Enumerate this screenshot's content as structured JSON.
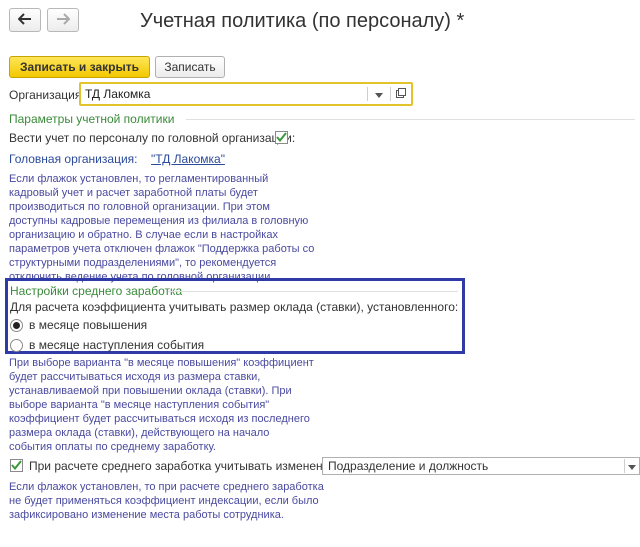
{
  "window": {
    "title": "Учетная политика (по персоналу) *"
  },
  "toolbar": {
    "save_close_label": "Записать и закрыть",
    "save_label": "Записать"
  },
  "organization": {
    "label": "Организация:",
    "value": "ТД Лакомка"
  },
  "params_section": {
    "title": "Параметры учетной политики",
    "head_org_checkbox_label": "Вести учет по персоналу по головной организации:",
    "head_org_checkbox_checked": true,
    "head_org_label": "Головная организация:",
    "head_org_link": "\"ТД Лакомка\"",
    "hint_lines": [
      "Если флажок установлен, то регламентированный",
      "кадровый учет и расчет заработной платы будет",
      "производиться по головной организации. При этом",
      "доступны кадровые перемещения из филиала в головную",
      "организацию и обратно. В случае если в настройках",
      "параметров учета отключен флажок \"Поддержка работы со",
      "структурными подразделениями\", то рекомендуется",
      "отключить ведение учета по головной организации."
    ]
  },
  "avg_salary_section": {
    "title": "Настройки среднего заработка",
    "question": "Для расчета коэффициента учитывать размер оклада (ставки), установленного:",
    "options": [
      "в месяце повышения",
      "в месяце наступления события"
    ],
    "selected_option": "в месяце повышения",
    "hint_lines": [
      "При выборе варианта \"в месяце повышения\" коэффициент",
      "будет рассчитываться исходя из размера ставки,",
      "устанавливаемой при повышении оклада (ставки). При",
      "выборе варианта \"в месяце наступления события\"",
      "коэффициент будет рассчитываться исходя из последнего",
      "размера оклада (ставки), действующего на начало",
      "события оплаты по среднему заработку."
    ]
  },
  "changes_section": {
    "checkbox_label": "При расчете среднего заработка учитывать изменения:",
    "checkbox_checked": true,
    "select_value": "Подразделение и должность",
    "hint_lines": [
      "Если флажок установлен, то при расчете среднего заработка",
      "не будет применяться коэффициент индексации, если было",
      "зафиксировано изменение места работы сотрудника."
    ]
  },
  "colors": {
    "primary_button": "#f2c800",
    "section_title": "#3a8a3a",
    "hint_text": "#4a4aa0",
    "highlight_frame": "#2e3aa8",
    "checkmark": "#3a9a3a"
  }
}
